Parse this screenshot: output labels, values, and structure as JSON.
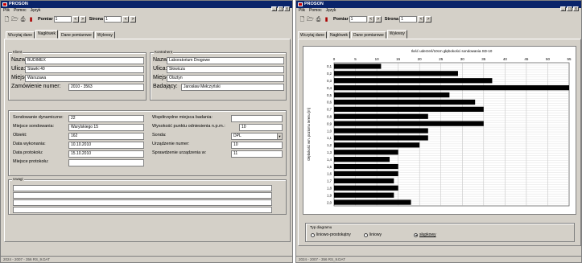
{
  "app": {
    "title": "PROSON",
    "menu": [
      "Plik",
      "Pomoc",
      "Język"
    ],
    "win_controls": [
      "_",
      "□",
      "x"
    ]
  },
  "toolbar": {
    "pomiar_label": "Pomiar",
    "pomiar_value": "1",
    "strona_label": "Strona",
    "strona_value": "1",
    "prev": "<",
    "next": ">"
  },
  "tabs": [
    "Wczytaj dane",
    "Nagłówek",
    "Dane pomiarowe",
    "Wykresy"
  ],
  "header": {
    "client_title": "Klient",
    "client": [
      {
        "label": "Nazwa:",
        "value": "BUDIMEX"
      },
      {
        "label": "Ulica:",
        "value": "Stawki 40"
      },
      {
        "label": "Miejsce:",
        "value": "Warszawa"
      },
      {
        "label": "Zamówienie numer:",
        "value": "2010 - 3563"
      }
    ],
    "contractor_title": "Kontrahent",
    "contractor": [
      {
        "label": "Nazwa:",
        "value": "Laboratorium Drogowe"
      },
      {
        "label": "Ulica:",
        "value": "Słowicza"
      },
      {
        "label": "Miejsce:",
        "value": "Olsztyn"
      },
      {
        "label": "Badający:",
        "value": "Jarosław Mełczyński"
      }
    ],
    "sounding": [
      {
        "label": "Sondowanie dynamiczne:",
        "value": "22"
      },
      {
        "label": "Miejsce sondowania:",
        "value": "Warylskiego 15"
      },
      {
        "label": "Obiekt:",
        "value": "162"
      },
      {
        "label": "Data wykonania:",
        "value": "10.10.2010"
      },
      {
        "label": "Data protokołu:",
        "value": "15.10.2010"
      },
      {
        "label": "Miejsce protokołu:",
        "value": ""
      }
    ],
    "coords": [
      {
        "label": "Współrzędne miejsca badania:",
        "value": ""
      },
      {
        "label": "Wysokość punktu odniesienia n.p.m.:",
        "value": "10"
      },
      {
        "label": "Sonda:",
        "value": "DPL"
      },
      {
        "label": "Urządzenie numer:",
        "value": "10"
      },
      {
        "label": "Sprawdzenie urządzenia w:",
        "value": "11"
      }
    ],
    "notes_title": "Uwagi"
  },
  "status": {
    "left": "2024 - 2007 - 356 RS_9.DAT",
    "right": "2024 - 2007 - 356 RS_9.DAT"
  },
  "chart_data": {
    "type": "bar",
    "orientation": "horizontal",
    "title": "Ilość uderzeń/10cm głębokości sondowania SD-10",
    "ylabel": "Głębokość wm. poziomu terenu [m]",
    "xlabel": "",
    "xlim": [
      0,
      55
    ],
    "xticks": [
      0,
      5,
      10,
      15,
      20,
      25,
      30,
      35,
      40,
      45,
      50,
      55
    ],
    "categories": [
      "0,1",
      "0,2",
      "0,3",
      "0,4",
      "0,5",
      "0,6",
      "0,7",
      "0,8",
      "0,9",
      "1,0",
      "1,1",
      "1,2",
      "1,3",
      "1,4",
      "1,5",
      "1,6",
      "1,7",
      "1,8",
      "1,9",
      "2,0"
    ],
    "values": [
      11,
      29,
      37,
      55,
      27,
      33,
      35,
      22,
      35,
      22,
      22,
      20,
      15,
      13,
      15,
      15,
      14,
      15,
      14,
      18
    ],
    "grid": true
  },
  "diagram_type": {
    "title": "Typ diagramu",
    "options": [
      {
        "label": "liniowo-prostokątny",
        "selected": false
      },
      {
        "label": "liniowy",
        "selected": false
      },
      {
        "label": "słupkowy",
        "selected": true
      }
    ]
  }
}
